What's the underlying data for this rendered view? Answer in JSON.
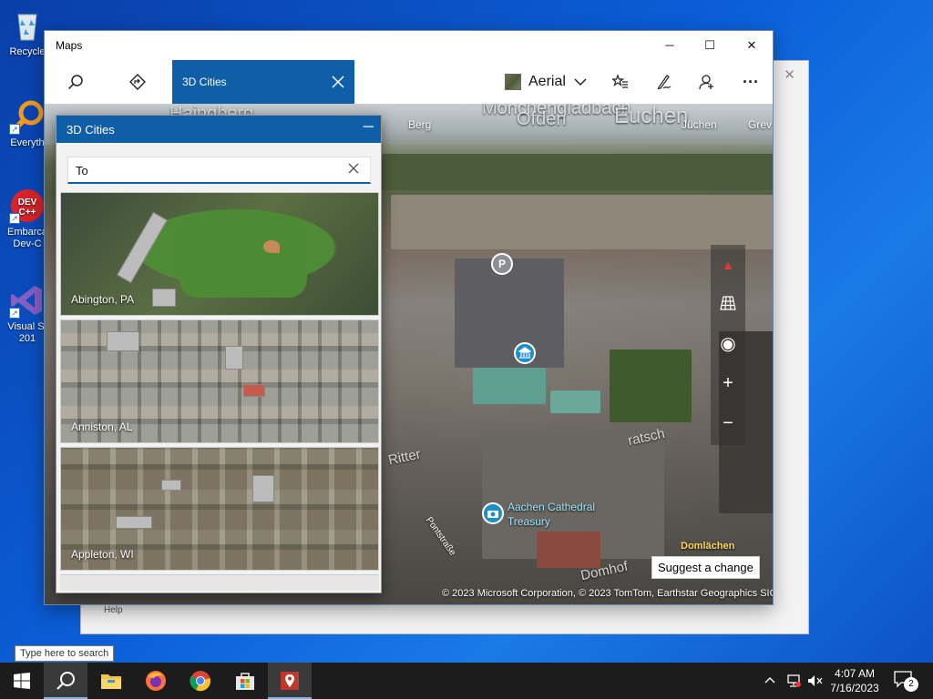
{
  "desktop": {
    "icons": [
      {
        "label": "Recycle",
        "icon": "recycle-bin-icon"
      },
      {
        "label": "Everyth",
        "icon": "everything-search-icon"
      },
      {
        "label": "Embarca",
        "label2": "Dev-C",
        "icon": "devcpp-icon",
        "badge": "DEV C++"
      },
      {
        "label": "Visual St",
        "label2": "201",
        "icon": "visual-studio-icon"
      }
    ]
  },
  "background_window": {
    "close_label": "✕",
    "help_label": "Help"
  },
  "maps": {
    "title": "Maps",
    "window_controls": {
      "minimize": "─",
      "maximize": "☐",
      "close": "✕"
    },
    "toolbar": {
      "search_icon": "search-icon",
      "directions_icon": "directions-icon",
      "tab_label": "3D Cities",
      "style_label": "Aerial",
      "favorites_icon": "favorites-icon",
      "ink_icon": "ink-pen-icon",
      "account_icon": "add-person-icon",
      "more_label": "···"
    },
    "map": {
      "labels": {
        "top_left": "Haingberg",
        "top_center": "Mönchengladbach",
        "sub_center": "Ofden",
        "faint_right": "Euchen",
        "berg": "Berg",
        "jochen": "Jüchen",
        "grev": "Grev",
        "street1": "Ritter",
        "street2": "ratsch",
        "street3": "Domhof",
        "street4": "Pontstraße",
        "domlaechen": "Domlächen",
        "cathedral": "Aachen Cathedral",
        "treasury": "Treasury"
      },
      "poi_parking": "P",
      "suggest_label": "Suggest a change",
      "copyright": "© 2023 Microsoft Corporation, © 2023 TomTom, Earthstar Geographics  SIO",
      "controls": {
        "compass": "▲",
        "tilt_icon": "grid-tilt-icon",
        "locate": "◉",
        "zoom_in": "+",
        "zoom_out": "−"
      }
    },
    "panel": {
      "title": "3D Cities",
      "minimize": "─",
      "search": {
        "value": "To",
        "placeholder": "",
        "clear_icon": "close-icon"
      },
      "cities": [
        {
          "name": "Abington, PA"
        },
        {
          "name": "Anniston, AL"
        },
        {
          "name": "Appleton, WI"
        }
      ]
    }
  },
  "taskbar": {
    "search_tooltip": "Type here to search",
    "apps": [
      "start-icon",
      "search-icon",
      "file-explorer-icon",
      "firefox-icon",
      "chrome-icon",
      "store-icon",
      "maps-icon"
    ],
    "clock_time": "4:07 AM",
    "clock_date": "7/16/2023",
    "notification_count": "2"
  }
}
